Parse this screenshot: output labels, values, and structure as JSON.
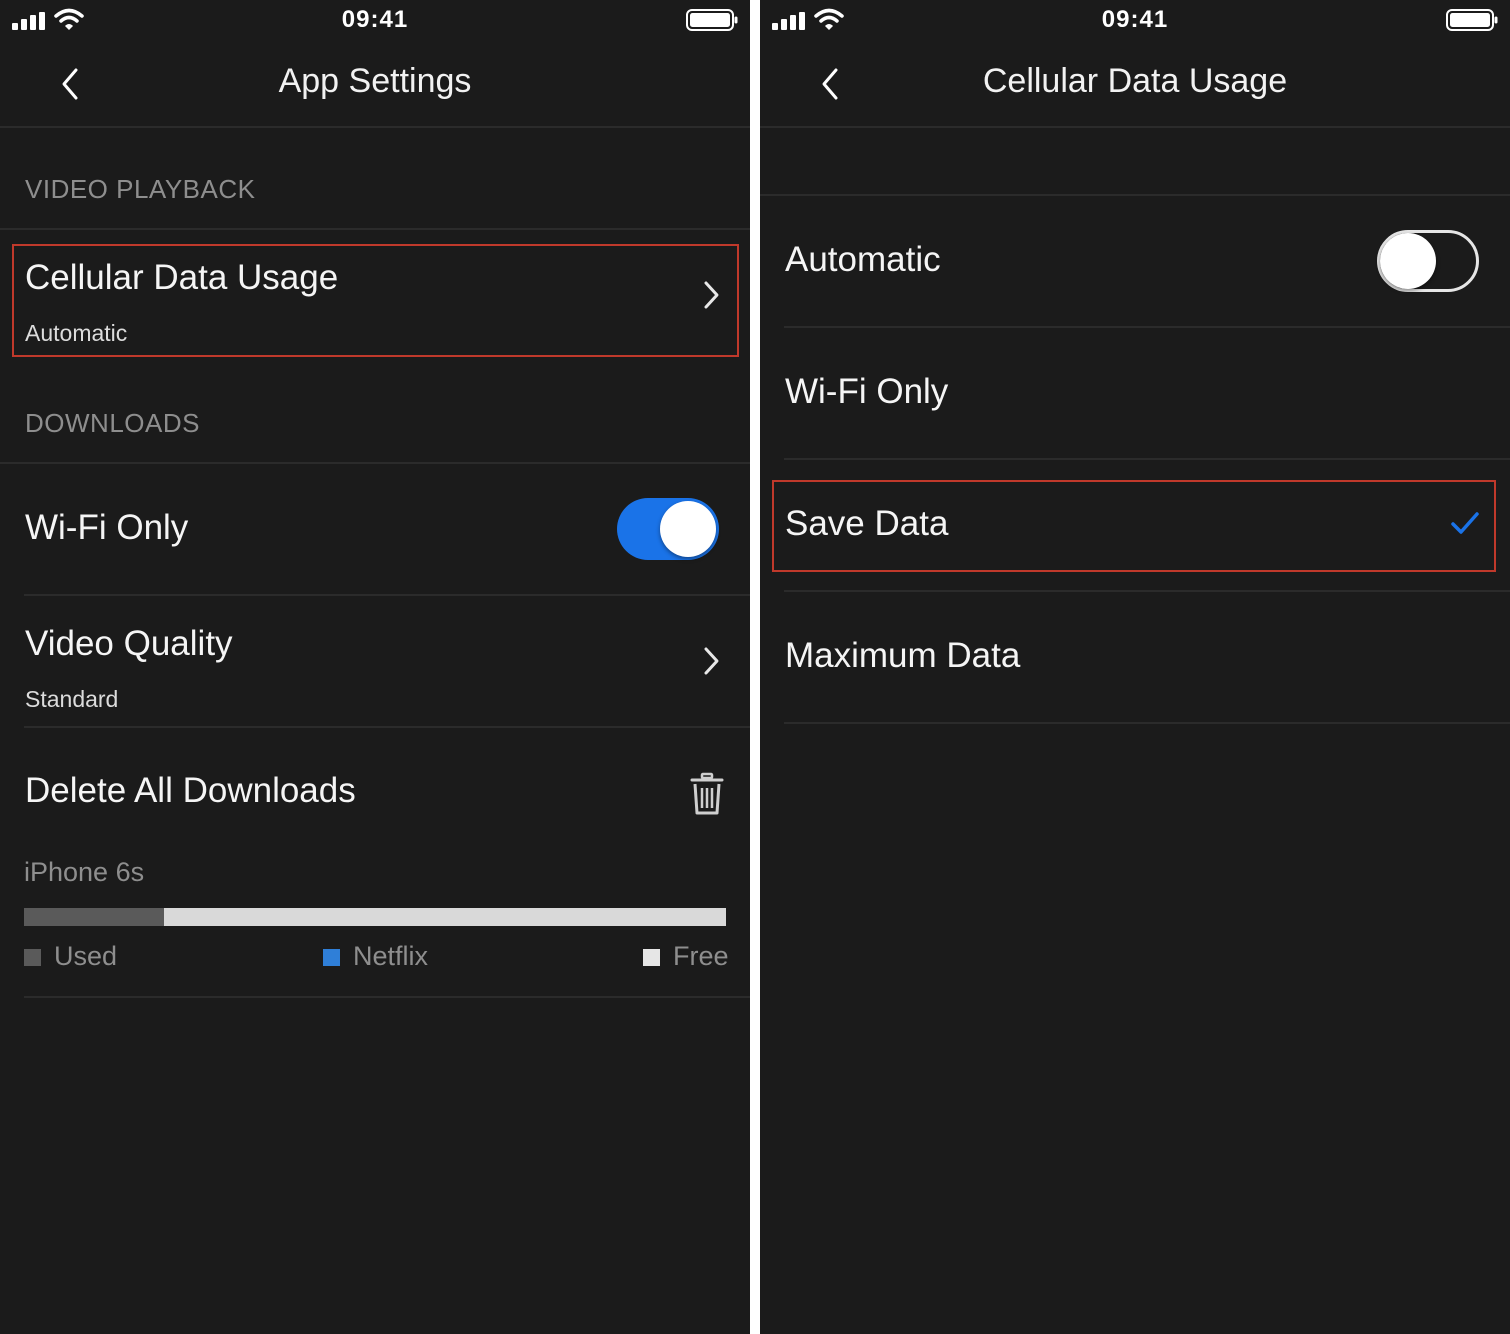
{
  "left_screen": {
    "status_bar": {
      "time": "09:41"
    },
    "nav": {
      "title": "App Settings"
    },
    "video_playback": {
      "header": "VIDEO PLAYBACK",
      "cellular": {
        "title": "Cellular Data Usage",
        "value": "Automatic"
      }
    },
    "downloads": {
      "header": "DOWNLOADS",
      "wifi_only": {
        "title": "Wi-Fi Only",
        "enabled": true
      },
      "video_quality": {
        "title": "Video Quality",
        "value": "Standard"
      },
      "delete_all": {
        "title": "Delete All Downloads"
      }
    },
    "storage": {
      "device": "iPhone 6s",
      "used_fraction": 0.2,
      "netflix_fraction": 0.0,
      "legend": {
        "used": "Used",
        "netflix": "Netflix",
        "free": "Free"
      },
      "colors": {
        "used": "#5a5a5a",
        "netflix": "#2f7fd8",
        "free": "#d9d9d9"
      }
    }
  },
  "right_screen": {
    "status_bar": {
      "time": "09:41"
    },
    "nav": {
      "title": "Cellular Data Usage"
    },
    "options": {
      "automatic": {
        "label": "Automatic",
        "enabled": false
      },
      "wifi_only": {
        "label": "Wi-Fi Only"
      },
      "save_data": {
        "label": "Save Data",
        "selected": true
      },
      "maximum_data": {
        "label": "Maximum Data"
      }
    }
  },
  "colors": {
    "background": "#1b1b1b",
    "accent": "#1a73e8",
    "highlight": "#c0392b"
  }
}
